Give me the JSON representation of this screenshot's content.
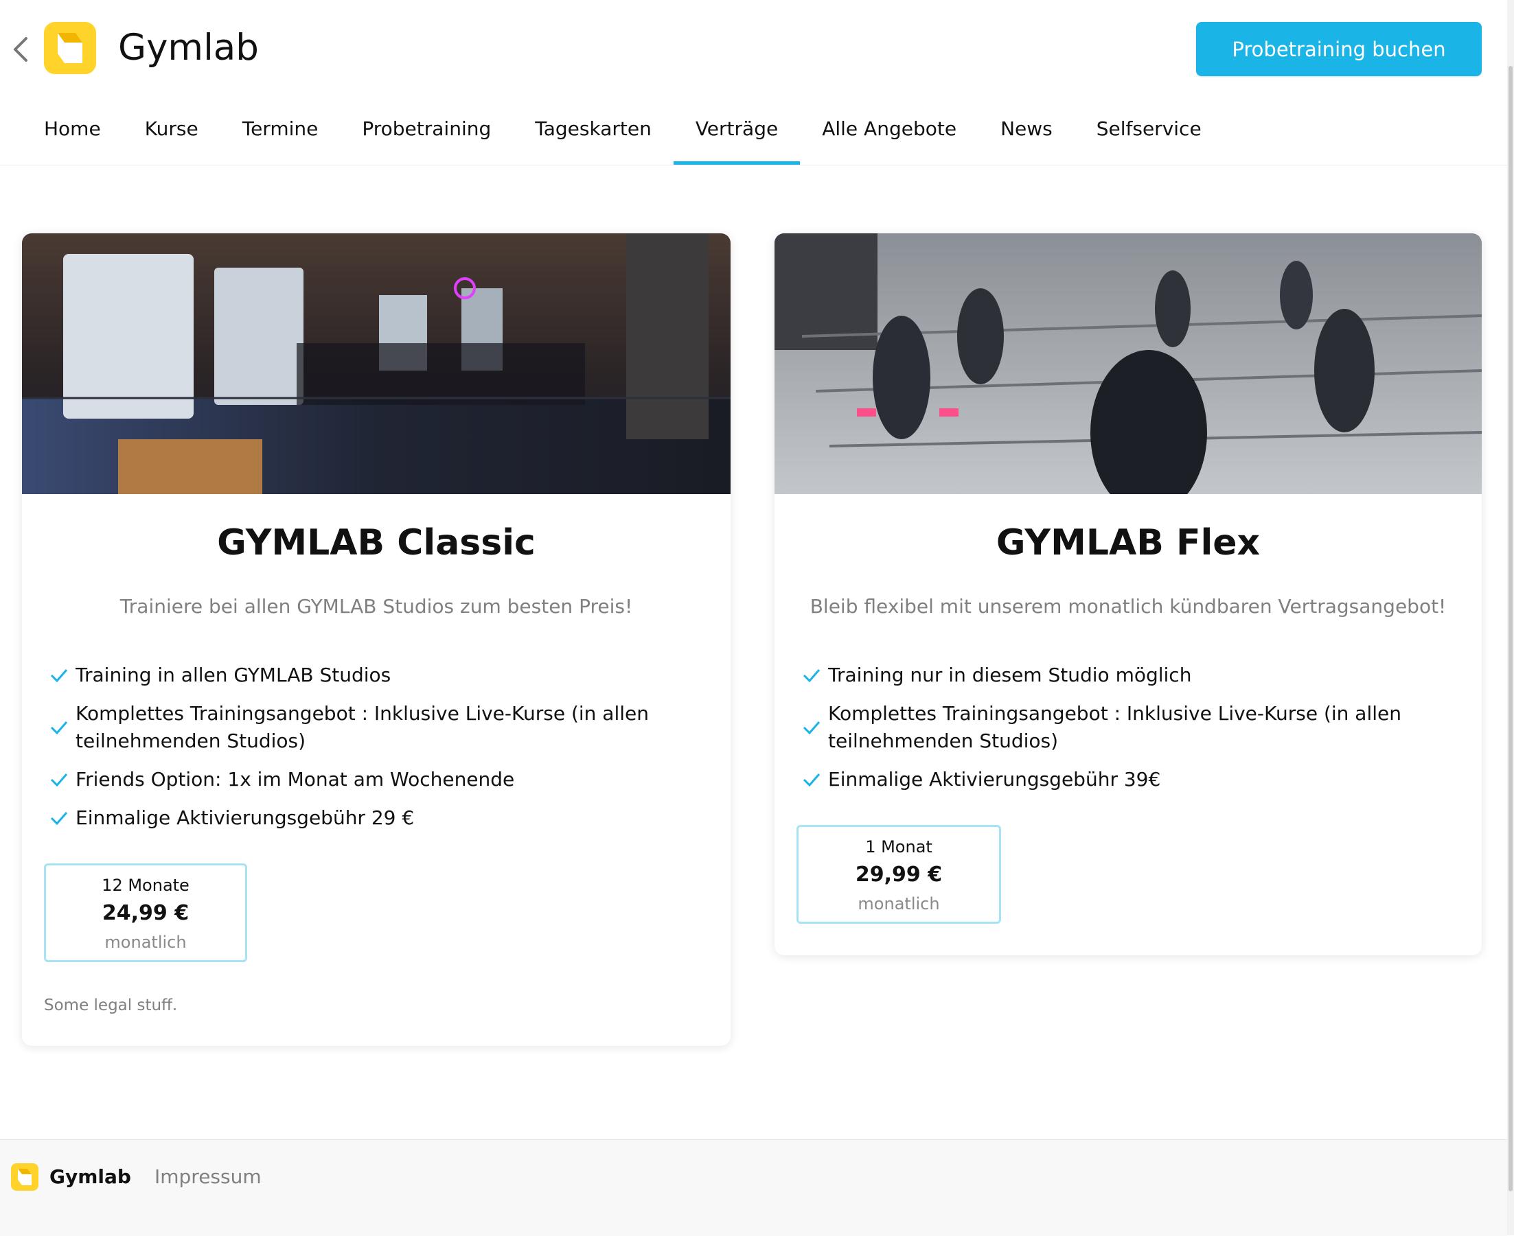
{
  "header": {
    "brand": "Gymlab",
    "cta_label": "Probetraining buchen"
  },
  "nav": {
    "items": [
      "Home",
      "Kurse",
      "Termine",
      "Probetraining",
      "Tageskarten",
      "Verträge",
      "Alle Angebote",
      "News",
      "Selfservice"
    ],
    "active": "Verträge"
  },
  "cards": [
    {
      "title": "GYMLAB Classic",
      "subtitle": "Trainiere bei allen GYMLAB Studios zum besten Preis!",
      "features": [
        "Training in allen GYMLAB Studios",
        "Komplettes Trainingsangebot : Inklusive Live-Kurse (in allen teilnehmenden Studios)",
        "Friends Option: 1x im Monat am Wochenende",
        "Einmalige Aktivierungsgebühr 29 €"
      ],
      "price": {
        "period": "12 Monate",
        "amount": "24,99 €",
        "unit": "monatlich"
      },
      "legal": "Some legal stuff."
    },
    {
      "title": "GYMLAB Flex",
      "subtitle": "Bleib flexibel mit unserem monatlich kündbaren Vertragsangebot!",
      "features": [
        "Training nur in diesem Studio möglich",
        "Komplettes Trainingsangebot : Inklusive Live-Kurse (in allen teilnehmenden Studios)",
        "Einmalige Aktivierungsgebühr 39€"
      ],
      "price": {
        "period": "1 Monat",
        "amount": "29,99 €",
        "unit": "monatlich"
      }
    }
  ],
  "footer": {
    "brand": "Gymlab",
    "link": "Impressum"
  },
  "colors": {
    "accent": "#1ab5e6",
    "logo_yellow": "#ffd32a",
    "price_border": "#a6e3f4"
  }
}
